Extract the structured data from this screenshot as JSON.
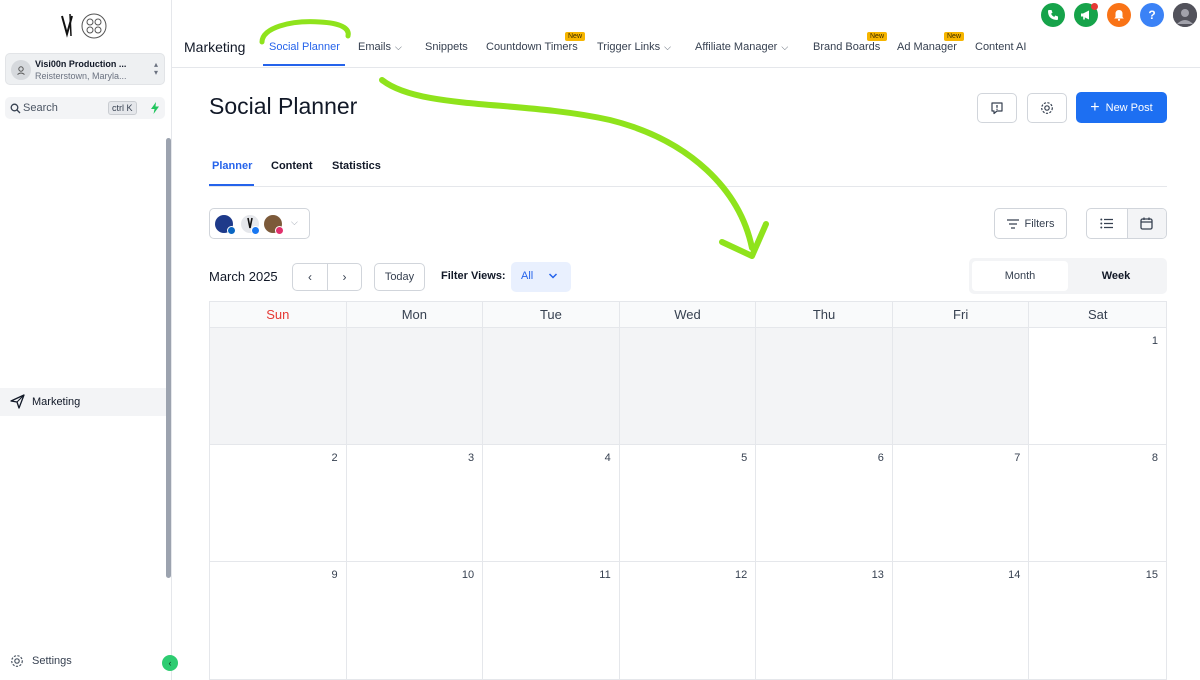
{
  "sidebar": {
    "account": {
      "name": "Visi00n Production ...",
      "location": "Reisterstown, Maryla..."
    },
    "search": {
      "label": "Search",
      "shortcut": "ctrl K"
    },
    "nav": {
      "marketing": "Marketing"
    },
    "settings": "Settings"
  },
  "topnav": {
    "section": "Marketing",
    "items": [
      {
        "label": "Social Planner",
        "active": true
      },
      {
        "label": "Emails"
      },
      {
        "label": "Snippets"
      },
      {
        "label": "Countdown Timers",
        "badge": "New"
      },
      {
        "label": "Trigger Links"
      },
      {
        "label": "Affiliate Manager"
      },
      {
        "label": "Brand Boards",
        "badge": "New"
      },
      {
        "label": "Ad Manager",
        "badge": "New"
      },
      {
        "label": "Content AI"
      }
    ],
    "help_label": "?"
  },
  "page": {
    "title": "Social Planner",
    "new_post": "New Post",
    "tabs": [
      "Planner",
      "Content",
      "Statistics"
    ]
  },
  "toolbar": {
    "filters": "Filters",
    "month_label": "March 2025",
    "today": "Today",
    "filter_views_label": "Filter Views:",
    "filter_views_value": "All",
    "period_month": "Month",
    "period_week": "Week"
  },
  "calendar": {
    "days": [
      "Sun",
      "Mon",
      "Tue",
      "Wed",
      "Thu",
      "Fri",
      "Sat"
    ],
    "weeks": [
      [
        "",
        "",
        "",
        "",
        "",
        "",
        "1"
      ],
      [
        "2",
        "3",
        "4",
        "5",
        "6",
        "7",
        "8"
      ],
      [
        "9",
        "10",
        "11",
        "12",
        "13",
        "14",
        "15"
      ]
    ]
  },
  "colors": {
    "accent": "#2563eb",
    "primary_button": "#1d6ff2",
    "annotation": "#8fe31c",
    "sunday": "#e53935",
    "new_badge": "#f6b500"
  }
}
